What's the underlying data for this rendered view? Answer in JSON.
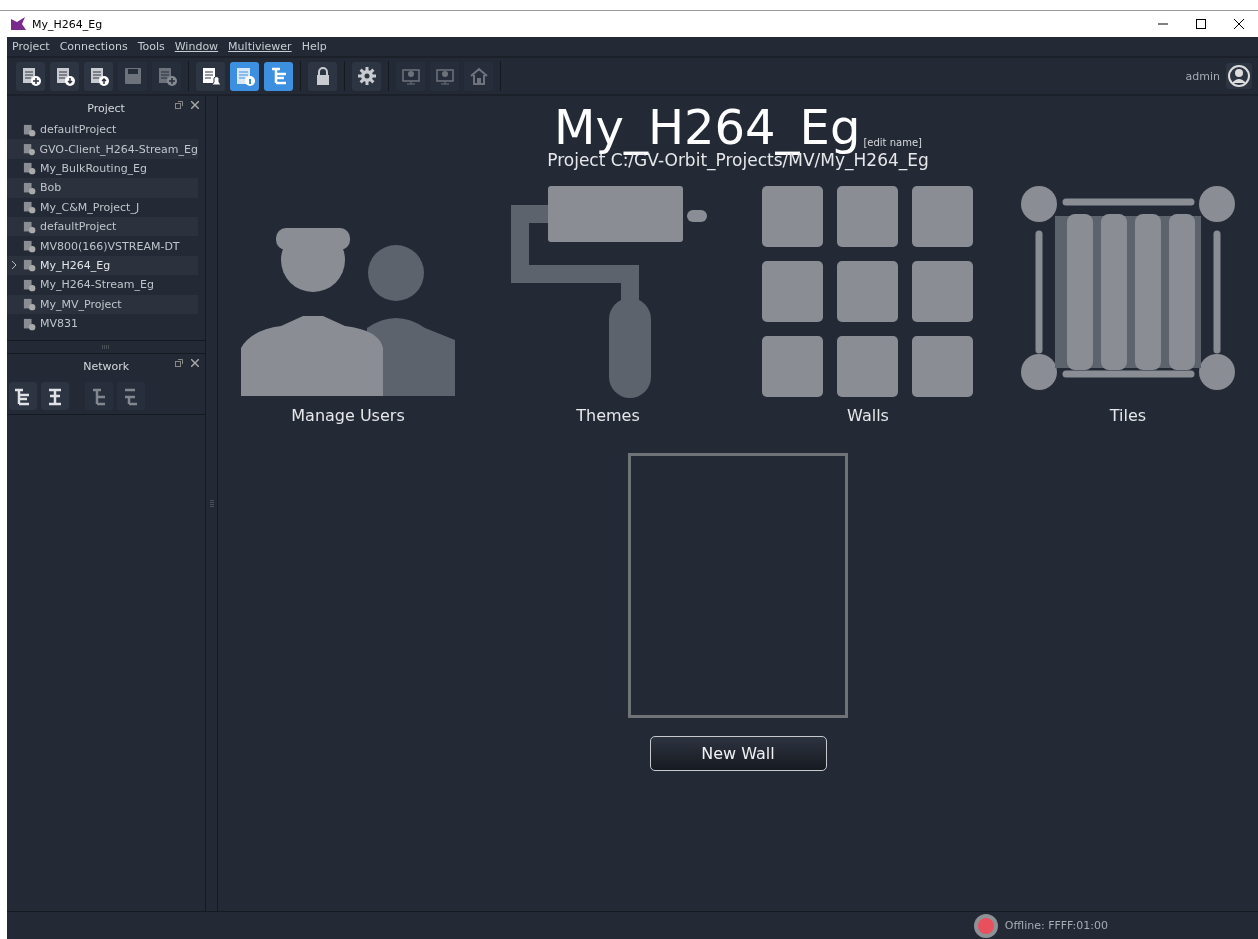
{
  "window": {
    "title": "My_H264_Eg"
  },
  "menu": [
    {
      "label": "Project",
      "mnemonic": false
    },
    {
      "label": "Connections",
      "mnemonic": false
    },
    {
      "label": "Tools",
      "mnemonic": false
    },
    {
      "label": "Window",
      "mnemonic": true
    },
    {
      "label": "Multiviewer",
      "mnemonic": true
    },
    {
      "label": "Help",
      "mnemonic": false
    }
  ],
  "toolbar": {
    "groups": [
      [
        {
          "kind": "new",
          "selected": false,
          "disabled": false
        },
        {
          "kind": "download",
          "selected": false,
          "disabled": false
        },
        {
          "kind": "upload",
          "selected": false,
          "disabled": false
        },
        {
          "kind": "save",
          "selected": false,
          "disabled": true
        },
        {
          "kind": "saveadd",
          "selected": false,
          "disabled": true
        }
      ],
      [
        {
          "kind": "alarm",
          "selected": false,
          "disabled": false
        },
        {
          "kind": "info",
          "selected": true,
          "disabled": false
        },
        {
          "kind": "tree",
          "selected": true,
          "disabled": false
        }
      ],
      [
        {
          "kind": "lock",
          "selected": false,
          "disabled": false
        }
      ],
      [
        {
          "kind": "gear",
          "selected": false,
          "disabled": false
        }
      ],
      [
        {
          "kind": "monitordown",
          "selected": false,
          "disabled": true
        },
        {
          "kind": "monitorup",
          "selected": false,
          "disabled": true
        },
        {
          "kind": "home",
          "selected": false,
          "disabled": true
        }
      ]
    ],
    "user": "admin"
  },
  "project_panel": {
    "title": "Project",
    "items": [
      {
        "label": "defaultProject",
        "current": false
      },
      {
        "label": "GVO-Client_H264-Stream_Eg",
        "current": false
      },
      {
        "label": "My_BulkRouting_Eg",
        "current": false
      },
      {
        "label": "Bob",
        "current": false
      },
      {
        "label": "My_C&M_Project_J",
        "current": false
      },
      {
        "label": "defaultProject",
        "current": false
      },
      {
        "label": "MV800(166)VSTREAM-DT",
        "current": false
      },
      {
        "label": "My_H264_Eg",
        "current": true
      },
      {
        "label": "My_H264-Stream_Eg",
        "current": false
      },
      {
        "label": "My_MV_Project",
        "current": false
      },
      {
        "label": "MV831",
        "current": false
      }
    ]
  },
  "network_panel": {
    "title": "Network",
    "buttons": [
      {
        "kind": "expand",
        "disabled": false
      },
      {
        "kind": "center",
        "disabled": false
      },
      {
        "kind": "collapse",
        "disabled": true
      },
      {
        "kind": "collapse2",
        "disabled": true
      }
    ]
  },
  "main": {
    "title": "My_H264_Eg",
    "edit_link": "[edit name]",
    "path": "Project C:/GV-Orbit_Projects/MV/My_H264_Eg",
    "tiles": [
      {
        "kind": "users",
        "label": "Manage Users"
      },
      {
        "kind": "themes",
        "label": "Themes"
      },
      {
        "kind": "walls",
        "label": "Walls"
      },
      {
        "kind": "tiles",
        "label": "Tiles"
      }
    ],
    "new_wall": "New Wall"
  },
  "status_bar": {
    "status": "Offline: FFFF:01:00",
    "online": false
  }
}
